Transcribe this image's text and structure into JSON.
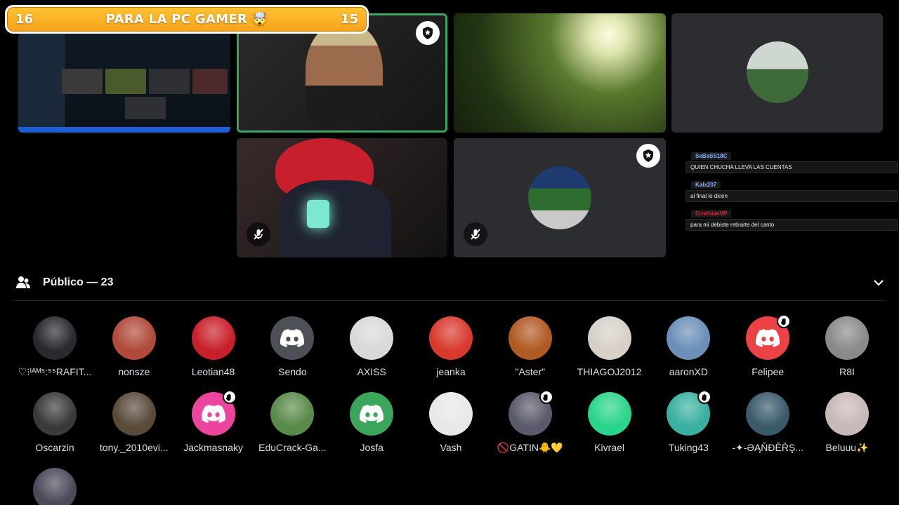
{
  "scoreboard": {
    "left_score": "16",
    "title": "PARA LA PC GAMER 🤯",
    "right_score": "15",
    "color": "#f7a21b"
  },
  "chat": [
    {
      "user": "SeBaSS18C",
      "user_color": "#8ab4ff",
      "text": "QUIEN CHUCHA LLEVA LAS CUENTAS"
    },
    {
      "user": "Kalx207",
      "user_color": "#8ab4ff",
      "text": "al final lo dicen"
    },
    {
      "user": "CristhianVP",
      "user_color": "#e0243a",
      "text": "para mi debiste retirarte del canto"
    }
  ],
  "audience": {
    "title": "Público — 23"
  },
  "members": [
    {
      "name": "♡⁝ᴵᴬᴹ⁵:⁵⁵RAFIT...",
      "color": "#2a2a2e",
      "discord": false,
      "hand": false
    },
    {
      "name": "nonsze",
      "color": "#b04a3a",
      "discord": false,
      "hand": false
    },
    {
      "name": "Leotian48",
      "color": "#c8202a",
      "discord": false,
      "hand": false
    },
    {
      "name": "Sendo",
      "color": "#4e5058",
      "discord": true,
      "hand": false
    },
    {
      "name": "AXISS",
      "color": "#d9d9d9",
      "discord": false,
      "hand": false
    },
    {
      "name": "jeanka",
      "color": "#d83a2e",
      "discord": false,
      "hand": false
    },
    {
      "name": "\"Aster\"",
      "color": "#b05a24",
      "discord": false,
      "hand": false
    },
    {
      "name": "THIAGOJ2012",
      "color": "#d6d0c8",
      "discord": false,
      "hand": false
    },
    {
      "name": "aaronXD",
      "color": "#6b8fb8",
      "discord": false,
      "hand": false
    },
    {
      "name": "Felipee",
      "color": "#ed4245",
      "discord": true,
      "hand": true
    },
    {
      "name": "R8I",
      "color": "#8a8a8a",
      "discord": false,
      "hand": false
    },
    {
      "name": "Oscarzin",
      "color": "#3a3a3a",
      "discord": false,
      "hand": false
    },
    {
      "name": "tony._2010evi...",
      "color": "#5a4a3a",
      "discord": false,
      "hand": false
    },
    {
      "name": "Jackmasnaky",
      "color": "#eb459e",
      "discord": true,
      "hand": true
    },
    {
      "name": "EduCrack-Ga...",
      "color": "#5a8a4a",
      "discord": false,
      "hand": false
    },
    {
      "name": "Josfa",
      "color": "#3ba55c",
      "discord": true,
      "hand": false
    },
    {
      "name": "Vash",
      "color": "#e8e8e8",
      "discord": false,
      "hand": false
    },
    {
      "name": "🚫GATIN🐥💛",
      "color": "#5a5a6a",
      "discord": false,
      "hand": true
    },
    {
      "name": "Kivrael",
      "color": "#2ad48a",
      "discord": false,
      "hand": false
    },
    {
      "name": "Tuking43",
      "color": "#3ab0a0",
      "discord": false,
      "hand": true
    },
    {
      "name": "-✦-ƏĄŇĐĚŘŞ...",
      "color": "#3a5a6a",
      "discord": false,
      "hand": false
    },
    {
      "name": "Beluuu✨",
      "color": "#c8b8b8",
      "discord": false,
      "hand": false
    },
    {
      "name": "",
      "color": "#4a4a5a",
      "discord": false,
      "hand": false
    }
  ]
}
